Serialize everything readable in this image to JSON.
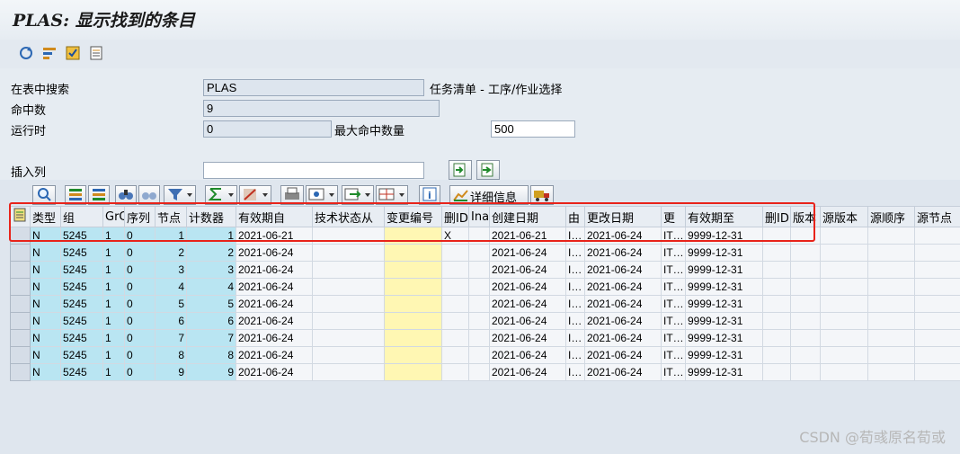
{
  "window": {
    "title": "PLAS: 显示找到的条目"
  },
  "form": {
    "search_label": "在表中搜索",
    "search_value": "PLAS",
    "search_desc": "任务清单 - 工序/作业选择",
    "hits_label": "命中数",
    "hits_value": "9",
    "runtime_label": "运行时",
    "runtime_value": "0",
    "max_hits_label": "最大命中数量",
    "max_hits_value": "500",
    "insert_col_label": "插入列",
    "insert_col_value": ""
  },
  "alv_toolbar": {
    "details_label": "详细信息"
  },
  "table": {
    "columns": [
      "类型",
      "组",
      "GrC",
      "序列",
      "节点",
      "计数器",
      "有效期自",
      "技术状态从",
      "变更编号",
      "删ID",
      "Ina",
      "创建日期",
      "由",
      "更改日期",
      "更",
      "有效期至",
      "删ID",
      "版本",
      "源版本",
      "源顺序",
      "源节点"
    ],
    "rows": [
      [
        "N",
        "5245",
        "1",
        "0",
        "1",
        "1",
        "2021-06-21",
        "",
        "",
        "X",
        "",
        "2021-06-21",
        "I…",
        "2021-06-24",
        "IT…",
        "9999-12-31",
        "",
        "",
        "",
        "",
        ""
      ],
      [
        "N",
        "5245",
        "1",
        "0",
        "2",
        "2",
        "2021-06-24",
        "",
        "",
        "",
        "",
        "2021-06-24",
        "I…",
        "2021-06-24",
        "IT…",
        "9999-12-31",
        "",
        "",
        "",
        "",
        ""
      ],
      [
        "N",
        "5245",
        "1",
        "0",
        "3",
        "3",
        "2021-06-24",
        "",
        "",
        "",
        "",
        "2021-06-24",
        "I…",
        "2021-06-24",
        "IT…",
        "9999-12-31",
        "",
        "",
        "",
        "",
        ""
      ],
      [
        "N",
        "5245",
        "1",
        "0",
        "4",
        "4",
        "2021-06-24",
        "",
        "",
        "",
        "",
        "2021-06-24",
        "I…",
        "2021-06-24",
        "IT…",
        "9999-12-31",
        "",
        "",
        "",
        "",
        ""
      ],
      [
        "N",
        "5245",
        "1",
        "0",
        "5",
        "5",
        "2021-06-24",
        "",
        "",
        "",
        "",
        "2021-06-24",
        "I…",
        "2021-06-24",
        "IT…",
        "9999-12-31",
        "",
        "",
        "",
        "",
        ""
      ],
      [
        "N",
        "5245",
        "1",
        "0",
        "6",
        "6",
        "2021-06-24",
        "",
        "",
        "",
        "",
        "2021-06-24",
        "I…",
        "2021-06-24",
        "IT…",
        "9999-12-31",
        "",
        "",
        "",
        "",
        ""
      ],
      [
        "N",
        "5245",
        "1",
        "0",
        "7",
        "7",
        "2021-06-24",
        "",
        "",
        "",
        "",
        "2021-06-24",
        "I…",
        "2021-06-24",
        "IT…",
        "9999-12-31",
        "",
        "",
        "",
        "",
        ""
      ],
      [
        "N",
        "5245",
        "1",
        "0",
        "8",
        "8",
        "2021-06-24",
        "",
        "",
        "",
        "",
        "2021-06-24",
        "I…",
        "2021-06-24",
        "IT…",
        "9999-12-31",
        "",
        "",
        "",
        "",
        ""
      ],
      [
        "N",
        "5245",
        "1",
        "0",
        "9",
        "9",
        "2021-06-24",
        "",
        "",
        "",
        "",
        "2021-06-24",
        "I…",
        "2021-06-24",
        "IT…",
        "9999-12-31",
        "",
        "",
        "",
        "",
        ""
      ]
    ]
  },
  "watermark": "CSDN @荀彧原名荀或",
  "colors": {
    "highlight_box": "#e8231a",
    "key_cell": "#b9e5f2",
    "change_cell": "#fff7b3"
  }
}
